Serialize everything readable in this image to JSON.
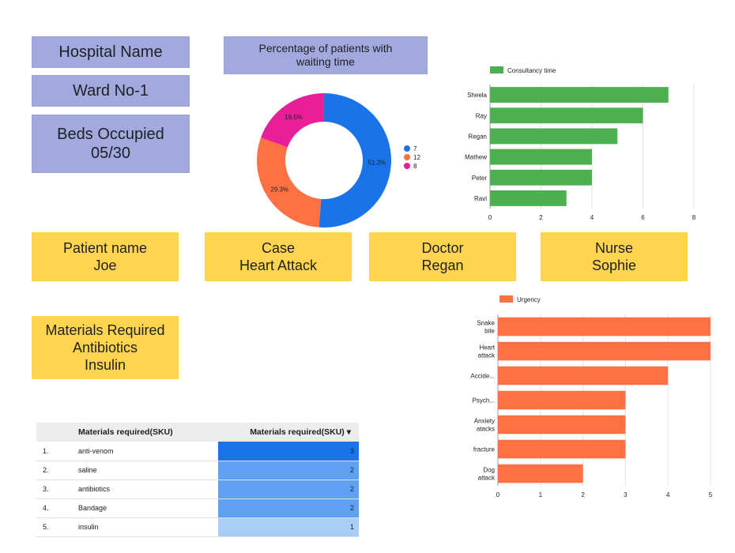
{
  "header": {
    "hospital": "Hospital Name",
    "ward": "Ward No-1",
    "beds_label": "Beds Occupied",
    "beds_value": "05/30",
    "donut_title_l1": "Percentage of patients with",
    "donut_title_l2": "waiting time"
  },
  "patient": {
    "name_label": "Patient name",
    "name_value": "Joe",
    "case_label": "Case",
    "case_value": "Heart Attack",
    "doctor_label": "Doctor",
    "doctor_value": "Regan",
    "nurse_label": "Nurse",
    "nurse_value": "Sophie",
    "materials_label": "Materials Required",
    "materials_item1": "Antibiotics",
    "materials_item2": "Insulin"
  },
  "colors": {
    "donut": [
      "#1a73e8",
      "#ff7043",
      "#e91e99"
    ],
    "consult_bar": "#4caf50",
    "urgency_bar": "#ff7043",
    "purple_card": "#a1a9de",
    "yellow_card": "#ffd54f"
  },
  "chart_data": [
    {
      "type": "pie",
      "title": "Percentage of patients with waiting time",
      "labels": [
        "7",
        "12",
        "8"
      ],
      "values": [
        51.2,
        29.3,
        19.5
      ],
      "value_labels": [
        "51.2%",
        "29.3%",
        "19.5%"
      ],
      "legend": "right"
    },
    {
      "type": "bar",
      "orientation": "horizontal",
      "categories": [
        "Sheela",
        "Ray",
        "Regan",
        "Mathew",
        "Peter",
        "Ravi"
      ],
      "series": [
        {
          "name": "Consultancy time",
          "values": [
            7,
            6,
            5,
            4,
            4,
            3
          ]
        }
      ],
      "xlim": [
        0,
        8
      ],
      "xticks": [
        "0",
        "2",
        "4",
        "6",
        "8"
      ],
      "legend": "top-left",
      "grid": true
    },
    {
      "type": "bar",
      "orientation": "horizontal",
      "categories": [
        [
          "Snake",
          "bite"
        ],
        [
          "Heart",
          "attack"
        ],
        [
          "Accide..."
        ],
        [
          "Psych..."
        ],
        [
          "Anxiety",
          "atacks"
        ],
        [
          "fracture"
        ],
        [
          "Dog",
          "attack"
        ]
      ],
      "series": [
        {
          "name": "Urgency",
          "values": [
            5,
            5,
            4,
            3,
            3,
            3,
            2
          ]
        }
      ],
      "xlim": [
        0,
        5
      ],
      "xticks": [
        "0",
        "1",
        "2",
        "3",
        "4",
        "5"
      ],
      "legend": "top-left",
      "grid": true
    },
    {
      "type": "table",
      "headers": [
        "Materials required(SKU)",
        "Materials required(SKU) ▾"
      ],
      "rows": [
        {
          "index": "1.",
          "name": "anti-venom",
          "value": 3
        },
        {
          "index": "2.",
          "name": "saline",
          "value": 2
        },
        {
          "index": "3.",
          "name": "antibiotics",
          "value": 2
        },
        {
          "index": "4.",
          "name": "Bandage",
          "value": 2
        },
        {
          "index": "5.",
          "name": "insulin",
          "value": 1
        }
      ]
    }
  ]
}
